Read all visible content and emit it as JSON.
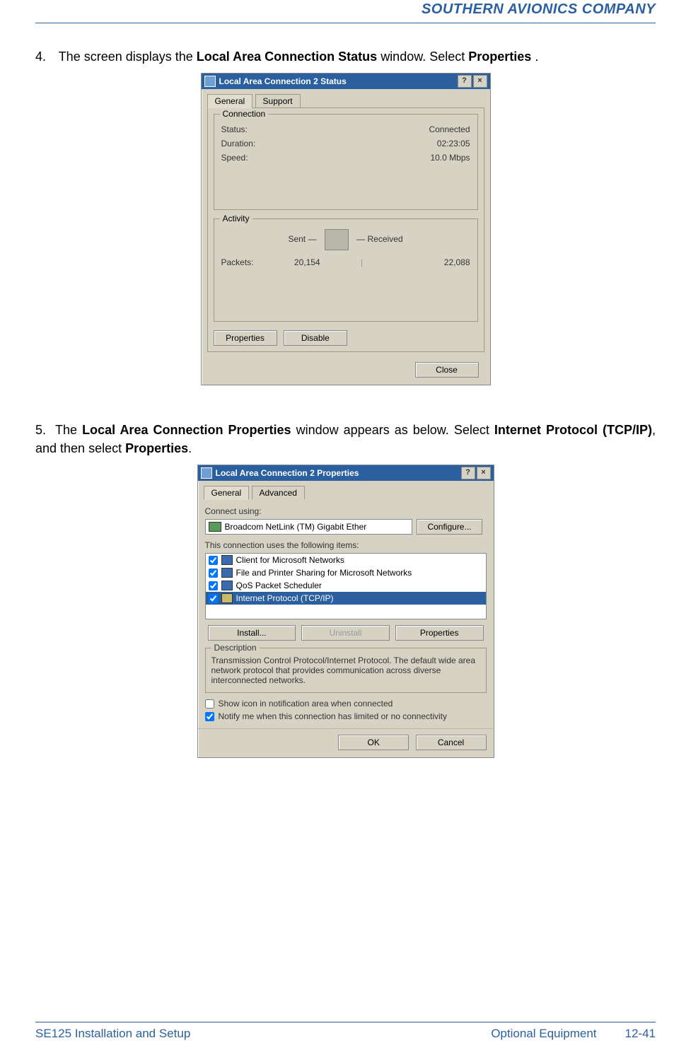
{
  "brand": "SOUTHERN AVIONICS COMPANY",
  "step4": {
    "num": "4.",
    "prefix": "The screen displays the ",
    "bold1": "Local Area Connection Status",
    "mid": " window.  Select ",
    "bold2": "Properties",
    "suffix": "."
  },
  "dlg1": {
    "title": "Local Area Connection 2 Status",
    "help": "?",
    "close": "×",
    "tabs": {
      "general": "General",
      "support": "Support"
    },
    "conn_legend": "Connection",
    "status_label": "Status:",
    "status_value": "Connected",
    "duration_label": "Duration:",
    "duration_value": "02:23:05",
    "speed_label": "Speed:",
    "speed_value": "10.0 Mbps",
    "activity_legend": "Activity",
    "sent": "Sent",
    "received": "Received",
    "packets_label": "Packets:",
    "packets_sent": "20,154",
    "packets_received": "22,088",
    "properties_btn": "Properties",
    "disable_btn": "Disable",
    "close_btn": "Close"
  },
  "step5": {
    "num": "5.",
    "prefix": "The ",
    "bold1": "Local Area Connection Properties",
    "mid1": " window appears as below. Select ",
    "bold2": "Internet Protocol (TCP/IP)",
    "mid2": ", and then select ",
    "bold3": "Properties",
    "suffix": "."
  },
  "dlg2": {
    "title": "Local Area Connection 2 Properties",
    "help": "?",
    "close": "×",
    "tabs": {
      "general": "General",
      "advanced": "Advanced"
    },
    "connect_using": "Connect using:",
    "adapter": "Broadcom NetLink (TM) Gigabit Ether",
    "configure": "Configure...",
    "uses_label": "This connection uses the following items:",
    "items": [
      "Client for Microsoft Networks",
      "File and Printer Sharing for Microsoft Networks",
      "QoS Packet Scheduler",
      "Internet Protocol (TCP/IP)"
    ],
    "install": "Install...",
    "uninstall": "Uninstall",
    "properties": "Properties",
    "desc_legend": "Description",
    "desc_text": "Transmission Control Protocol/Internet Protocol. The default wide area network protocol that provides communication across diverse interconnected networks.",
    "chk1": "Show icon in notification area when connected",
    "chk2": "Notify me when this connection has limited or no connectivity",
    "ok": "OK",
    "cancel": "Cancel"
  },
  "footer": {
    "left": "SE125 Installation and Setup",
    "section": "Optional Equipment",
    "page": "12-41"
  }
}
